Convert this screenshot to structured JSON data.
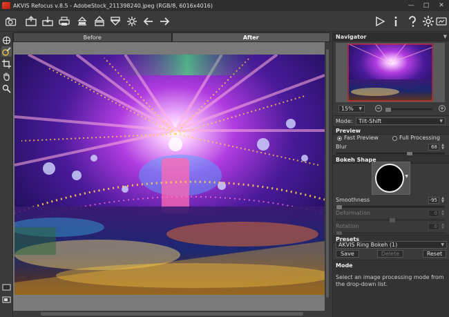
{
  "app": {
    "title": "AKVIS Refocus v.8.5 - AdobeStock_211398240.jpeg (RGB/8, 6016x4016)"
  },
  "canvas": {
    "tabs": [
      {
        "label": "Before",
        "active": false
      },
      {
        "label": "After",
        "active": true
      }
    ]
  },
  "navigator": {
    "title": "Navigator",
    "zoom": "15%"
  },
  "mode": {
    "label": "Mode:",
    "value": "Tilt-Shift"
  },
  "preview": {
    "title": "Preview",
    "fast_label": "Fast Preview",
    "full_label": "Full Processing",
    "selected": "fast"
  },
  "blur": {
    "label": "Blur",
    "value": "68"
  },
  "bokeh": {
    "title": "Bokeh Shape",
    "smoothness_label": "Smoothness",
    "smoothness_value": "-95",
    "deformation_label": "Deformation",
    "deformation_value": "0",
    "rotation_label": "Rotation",
    "rotation_value": "0"
  },
  "presets": {
    "title": "Presets",
    "selected": "AKVIS Ring Bokeh (1)",
    "save_label": "Save",
    "delete_label": "Delete",
    "reset_label": "Reset"
  },
  "help": {
    "title": "Mode",
    "text": "Select an image processing mode from the drop-down list."
  },
  "colors": {
    "panel_bg": "#3a3a3a",
    "header_bg": "#2e2e2e",
    "canvas_bg": "#7a7a7a"
  }
}
